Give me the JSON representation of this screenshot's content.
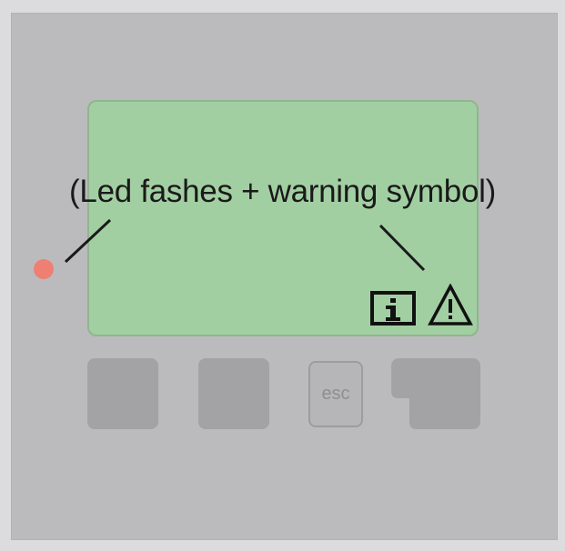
{
  "device": {
    "caption": "(Led fashes + warning symbol)",
    "led_color": "#ee7f72",
    "led_icon": "status-led",
    "display_icons": [
      "info-icon",
      "warning-icon"
    ],
    "buttons": [
      {
        "name": "button-1",
        "label": ""
      },
      {
        "name": "button-2",
        "label": ""
      },
      {
        "name": "esc-button",
        "label": "esc"
      },
      {
        "name": "button-4",
        "label": ""
      }
    ]
  }
}
